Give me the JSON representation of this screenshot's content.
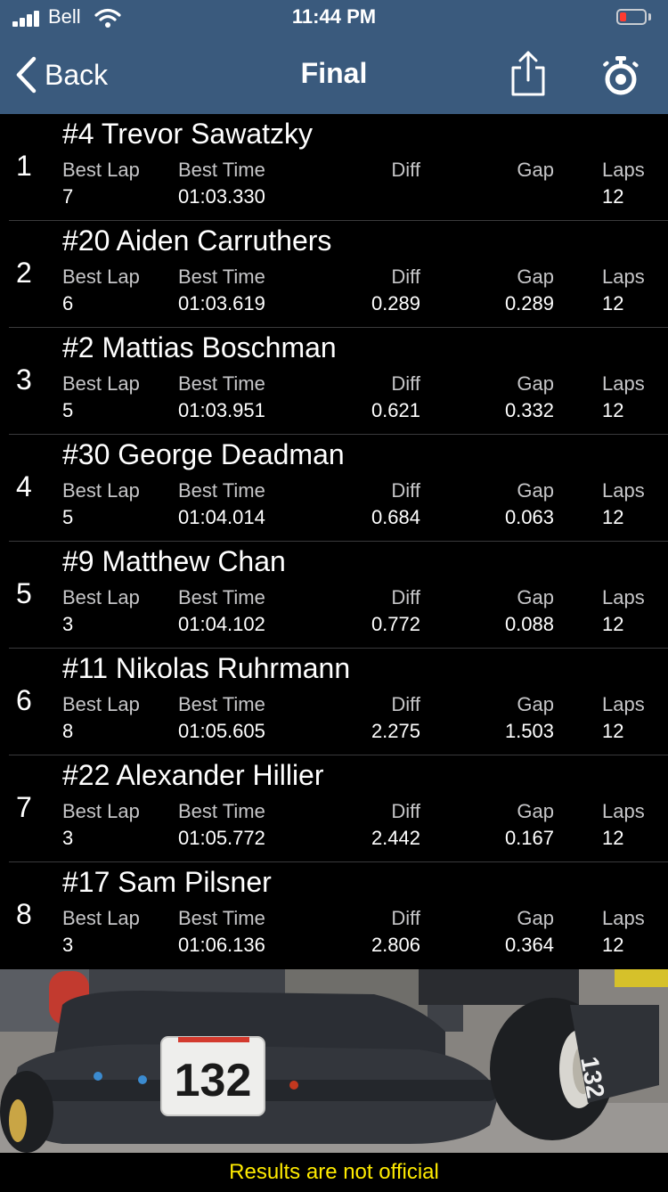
{
  "status": {
    "carrier": "Bell",
    "time": "11:44 PM",
    "battery_level": 0.15
  },
  "nav": {
    "back_label": "Back",
    "title": "Final",
    "icons": [
      "chevron-left-icon",
      "share-icon",
      "stopwatch-icon"
    ]
  },
  "columns": {
    "best_lap": "Best Lap",
    "best_time": "Best Time",
    "diff": "Diff",
    "gap": "Gap",
    "laps": "Laps"
  },
  "results": [
    {
      "pos": "1",
      "driver": "#4 Trevor Sawatzky",
      "best_lap": "7",
      "best_time": "01:03.330",
      "diff": "",
      "gap": "",
      "laps": "12"
    },
    {
      "pos": "2",
      "driver": "#20 Aiden Carruthers",
      "best_lap": "6",
      "best_time": "01:03.619",
      "diff": "0.289",
      "gap": "0.289",
      "laps": "12"
    },
    {
      "pos": "3",
      "driver": "#2 Mattias Boschman",
      "best_lap": "5",
      "best_time": "01:03.951",
      "diff": "0.621",
      "gap": "0.332",
      "laps": "12"
    },
    {
      "pos": "4",
      "driver": "#30 George Deadman",
      "best_lap": "5",
      "best_time": "01:04.014",
      "diff": "0.684",
      "gap": "0.063",
      "laps": "12"
    },
    {
      "pos": "5",
      "driver": "#9 Matthew Chan",
      "best_lap": "3",
      "best_time": "01:04.102",
      "diff": "0.772",
      "gap": "0.088",
      "laps": "12"
    },
    {
      "pos": "6",
      "driver": "#11 Nikolas Ruhrmann",
      "best_lap": "8",
      "best_time": "01:05.605",
      "diff": "2.275",
      "gap": "1.503",
      "laps": "12"
    },
    {
      "pos": "7",
      "driver": "#22 Alexander Hillier",
      "best_lap": "3",
      "best_time": "01:05.772",
      "diff": "2.442",
      "gap": "0.167",
      "laps": "12"
    },
    {
      "pos": "8",
      "driver": "#17 Sam Pilsner",
      "best_lap": "3",
      "best_time": "01:06.136",
      "diff": "2.806",
      "gap": "0.364",
      "laps": "12"
    }
  ],
  "photo": {
    "kart_number": "132",
    "side_number": "132"
  },
  "footer": {
    "notice": "Results are not official"
  },
  "colors": {
    "nav_bg": "#3a5a7d",
    "notice": "#ffeb00",
    "battery_low": "#ff3b30"
  }
}
